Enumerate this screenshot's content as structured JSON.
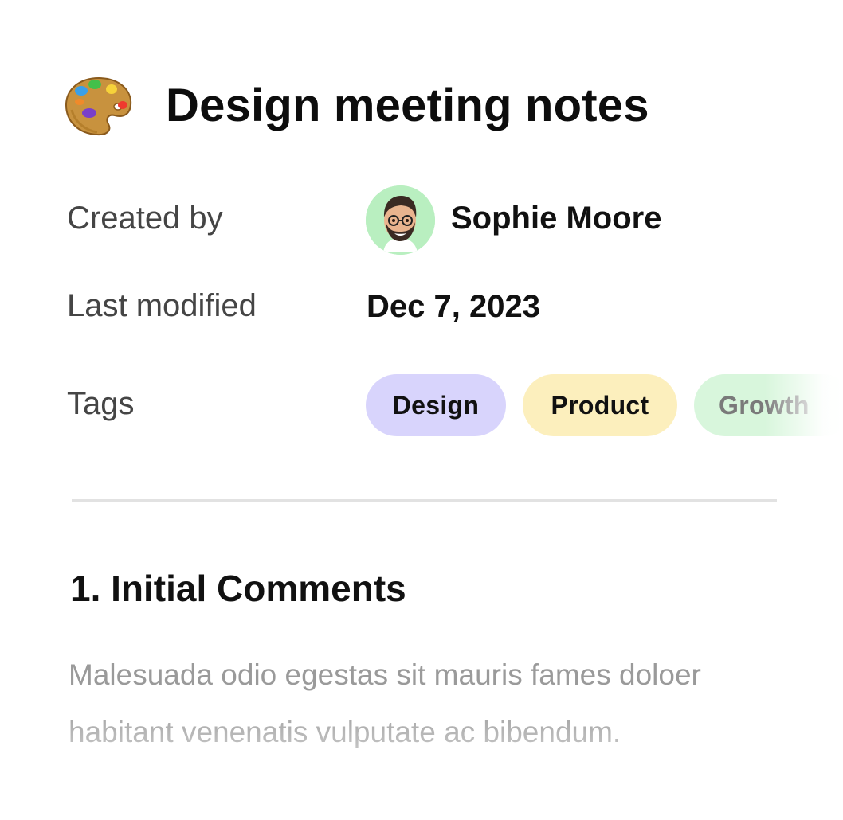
{
  "document": {
    "title": "Design meeting notes",
    "title_icon": "artist-palette-icon"
  },
  "properties": {
    "created_by": {
      "label": "Created by",
      "name": "Sophie Moore",
      "avatar_icon": "memoji-avatar"
    },
    "last_modified": {
      "label": "Last modified",
      "value": "Dec 7, 2023"
    },
    "tags": {
      "label": "Tags",
      "items": [
        {
          "label": "Design",
          "color": "#d8d4fc"
        },
        {
          "label": "Product",
          "color": "#fcefbd"
        },
        {
          "label": "Growth",
          "color": "#d8f6dc"
        }
      ]
    }
  },
  "section": {
    "heading": "1. Initial Comments",
    "body": "Malesuada odio egestas sit mauris fames doloer habitant venenatis vulputate ac bibendum."
  }
}
